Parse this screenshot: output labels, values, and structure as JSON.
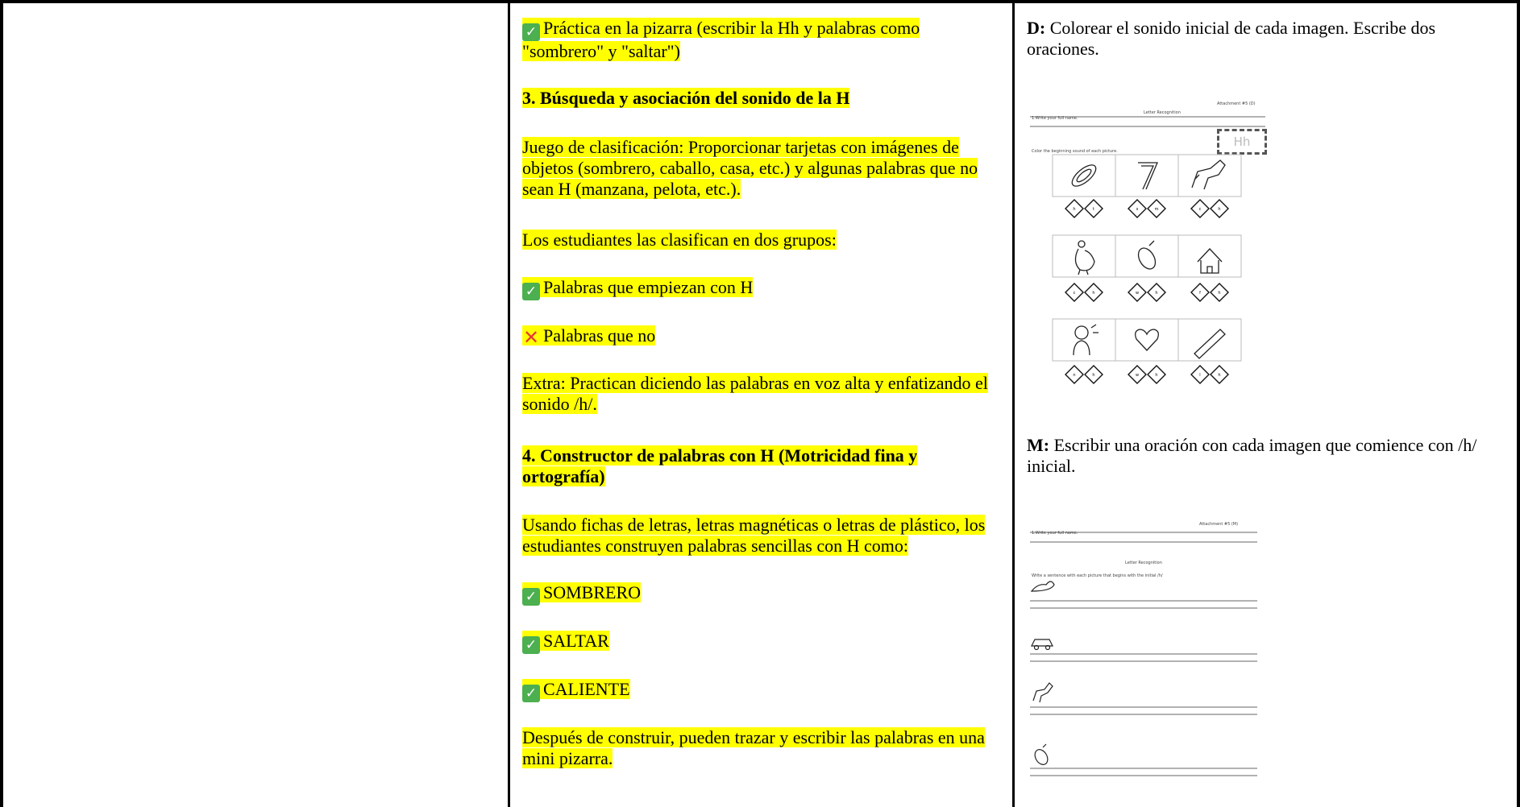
{
  "col2": {
    "p1_text": "Práctica en la pizarra (escribir la Hh y palabras como \"sombrero\" y \"saltar\")",
    "h3": "3. Búsqueda y asociación del sonido de la H",
    "p2": "Juego de clasificación: Proporcionar tarjetas con imágenes de objetos (sombrero, caballo, casa, etc.) y algunas palabras que no sean H (manzana, pelota, etc.).",
    "p3": "Los estudiantes las clasifican en dos grupos:",
    "p4_text": "Palabras que empiezan con H",
    "p5_text": "Palabras que no",
    "p6": "Extra: Practican diciendo las palabras en voz alta y enfatizando el sonido /h/.",
    "h4": "4. Constructor de palabras con H (Motricidad fina y ortografía)",
    "p7": "Usando fichas de letras, letras magnéticas o letras de plástico, los estudiantes construyen palabras sencillas con H como:",
    "w1": "SOMBRERO",
    "w2": "SALTAR",
    "w3": "CALIENTE",
    "p8": "Después de construir, pueden trazar y escribir las palabras en una mini pizarra."
  },
  "col3": {
    "d_label": "D:",
    "d_text": "Colorear el sonido inicial de cada imagen. Escribe dos oraciones.",
    "m_label": "M:",
    "m_text": "Escribir una oración con cada imagen que comience con /h/ inicial.",
    "ws1": {
      "attachment": "Attachment #5 (D)",
      "title": "Letter Recognition",
      "name_label": "1.Write your full name.",
      "instruction": "Color the beginning sound of each picture.",
      "letter_box": "Hh",
      "choices": [
        [
          "h",
          "t"
        ],
        [
          "s",
          "m"
        ],
        [
          "c",
          "h"
        ],
        [
          "c",
          "h"
        ],
        [
          "w",
          "h"
        ],
        [
          "f",
          "h"
        ],
        [
          "n",
          "h"
        ],
        [
          "w",
          "h"
        ],
        [
          "l",
          "h"
        ]
      ]
    },
    "ws2": {
      "attachment": "Attachment #5 (M)",
      "name_label": "1.Write your full name.",
      "title": "Letter Recognition",
      "instruction": "Write a sentence with each picture that begins with the initial /h/"
    }
  },
  "colors": {
    "highlight": "#ffff00",
    "check": "#4caf50",
    "cross": "#e53935"
  },
  "icons": [
    "check-icon",
    "cross-icon"
  ]
}
